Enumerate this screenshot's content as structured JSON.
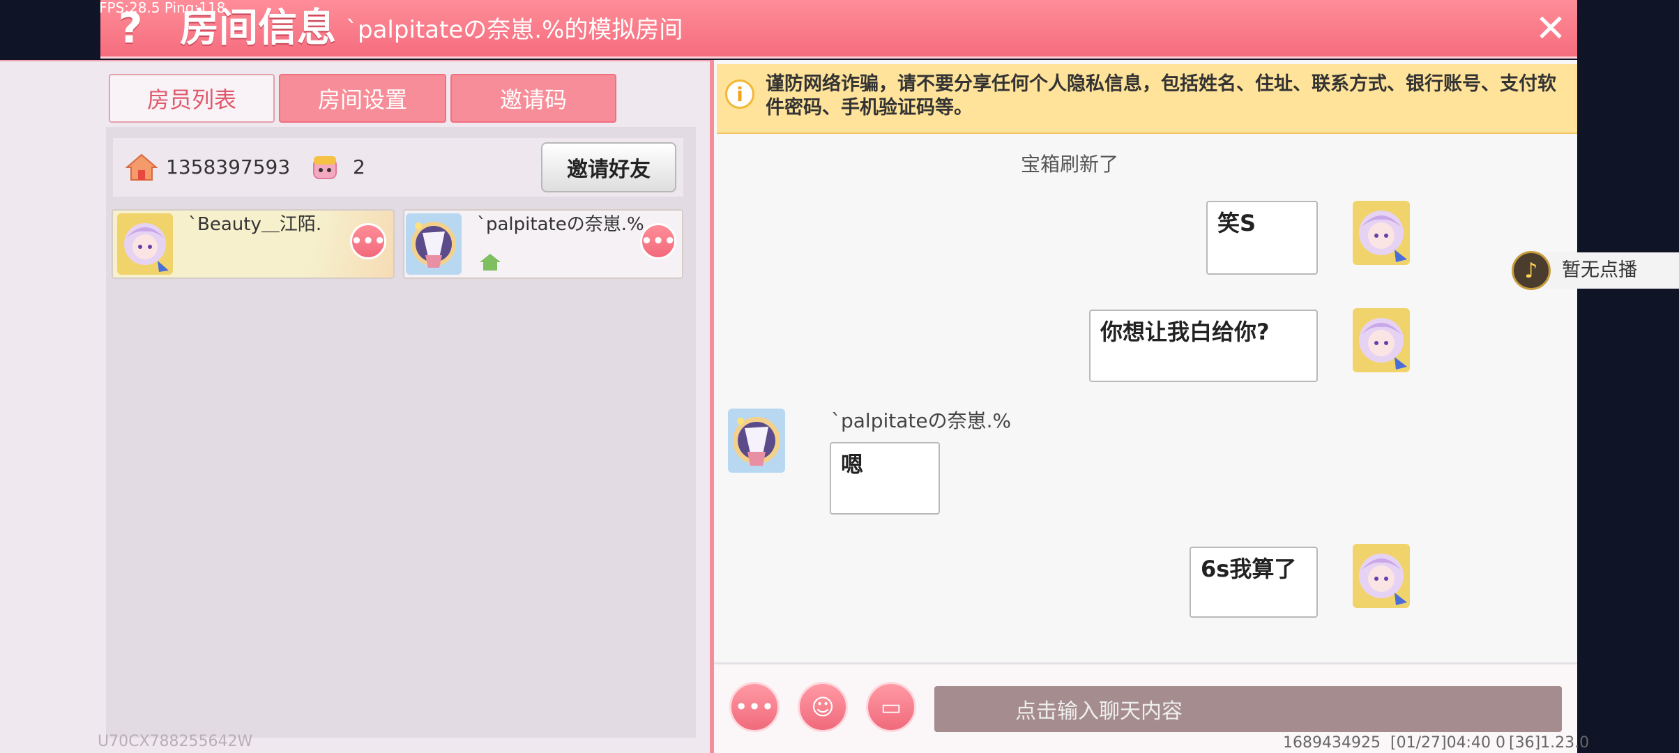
{
  "overlay": {
    "fps_ping": "FPS:28.5  Ping:118"
  },
  "header": {
    "help_icon": "?",
    "title": "房间信息",
    "room_name": "ˋpalpitateの奈崽.%的模拟房间",
    "close_icon": "✕"
  },
  "tabs": [
    {
      "label": "房员列表",
      "active": true
    },
    {
      "label": "房间设置",
      "active": false
    },
    {
      "label": "邀请码",
      "active": false
    }
  ],
  "room_info": {
    "room_id": "1358397593",
    "member_count": "2",
    "invite_button": "邀请好友"
  },
  "members": [
    {
      "name": "ˋBeauty＿江陌.",
      "more_icon": "•••"
    },
    {
      "name": "ˋpalpitateの奈崽.%",
      "more_icon": "•••"
    }
  ],
  "uid_text": "U70CX788255642W",
  "chat": {
    "warning_icon": "i",
    "warning": "谨防网络诈骗，请不要分享任何个人隐私信息，包括姓名、住址、联系方式、银行账号、支付软件密码、手机验证码等。",
    "system_message": "宝箱刷新了",
    "messages": [
      {
        "side": "right",
        "text": "笑S"
      },
      {
        "side": "right",
        "text": "你想让我白给你?"
      },
      {
        "side": "left",
        "sender": "ˋpalpitateの奈崽.%",
        "text": "嗯"
      },
      {
        "side": "right",
        "text": "6s我算了"
      }
    ]
  },
  "input_bar": {
    "more_icon": "•••",
    "emoji_icon": "☺",
    "keyboard_icon": "▭",
    "placeholder": "点击输入聊天内容"
  },
  "footer": {
    "id": "1689434925",
    "timestamp": "[01/27]04:40 0",
    "version": "[36]1.23.0"
  },
  "music": {
    "icon": "♪",
    "text": "暂无点播"
  },
  "colors": {
    "header_pink": "#f56d7e",
    "tab_active_text": "#e0586c",
    "warning_bg": "#ffe39a",
    "input_bg": "#a58c8f",
    "host_green": "#7fbf5f"
  }
}
